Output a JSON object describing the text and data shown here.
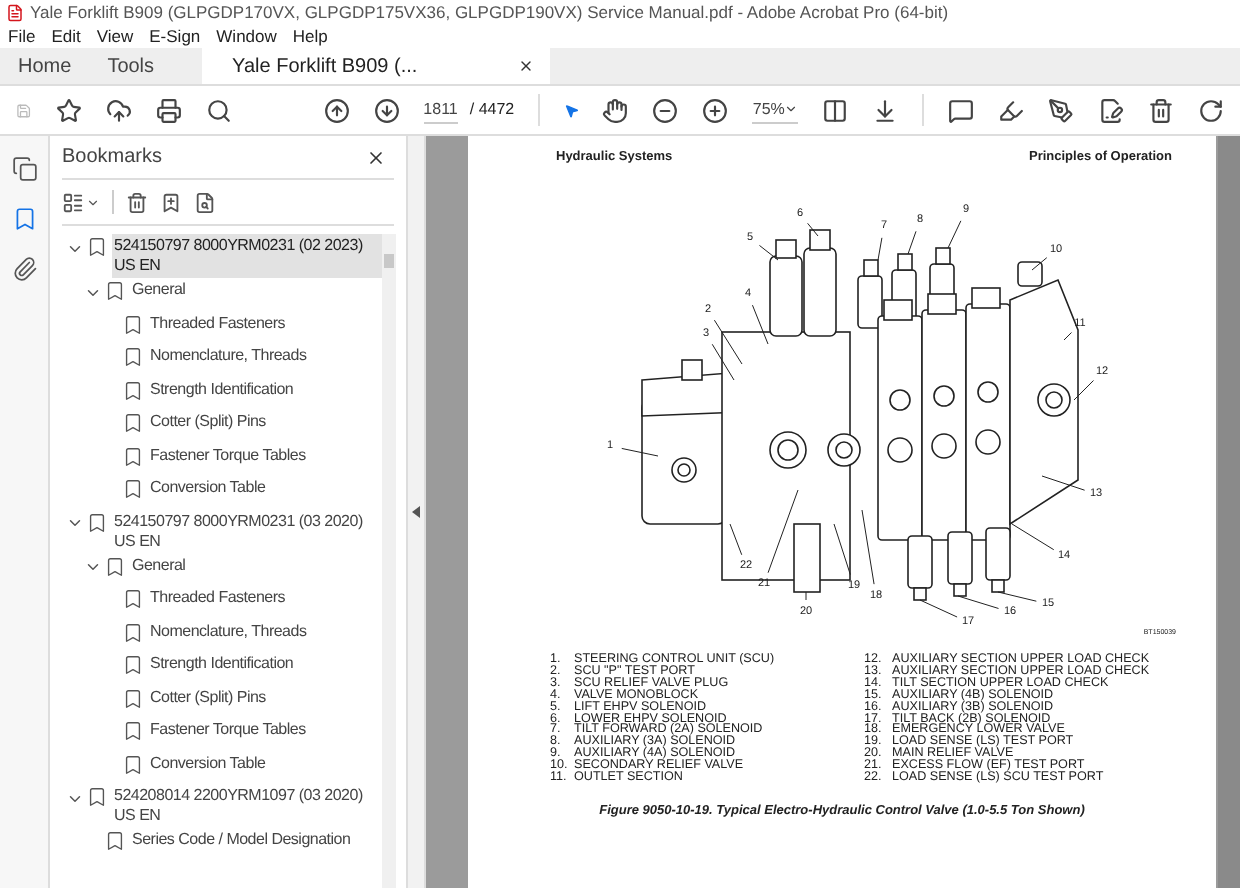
{
  "window": {
    "title": "Yale Forklift B909 (GLPGDP170VX, GLPGDP175VX36, GLPGDP190VX) Service Manual.pdf - Adobe Acrobat Pro (64-bit)"
  },
  "menu": [
    "File",
    "Edit",
    "View",
    "E-Sign",
    "Window",
    "Help"
  ],
  "tabs": [
    {
      "label": "Home",
      "selected": false,
      "kind": "nav"
    },
    {
      "label": "Tools",
      "selected": false,
      "kind": "nav"
    },
    {
      "label": "Yale Forklift B909 (...",
      "selected": true,
      "kind": "document"
    }
  ],
  "toolbar": {
    "page": "1811",
    "page_count": "/ 4472",
    "zoom": "75%"
  },
  "side_rail": [
    {
      "kind": "pages",
      "selected": false
    },
    {
      "kind": "bookmarks",
      "selected": true
    },
    {
      "kind": "attachments",
      "selected": false
    }
  ],
  "bookmarks": {
    "title": "Bookmarks",
    "items": [
      {
        "label": "524150797 8000YRM0231 (02 2023) US EN",
        "selected": true,
        "expanded": true,
        "children": [
          {
            "label": "General",
            "selected": false,
            "expanded": true,
            "children": [
              {
                "label": "Threaded Fasteners",
                "selected": false
              },
              {
                "label": "Nomenclature, Threads",
                "selected": false
              },
              {
                "label": "Strength Identification",
                "selected": false
              },
              {
                "label": "Cotter (Split) Pins",
                "selected": false
              },
              {
                "label": "Fastener Torque Tables",
                "selected": false
              },
              {
                "label": "Conversion Table",
                "selected": false
              }
            ]
          }
        ]
      },
      {
        "label": "524150797 8000YRM0231 (03 2020) US EN",
        "selected": false,
        "expanded": true,
        "children": [
          {
            "label": "General",
            "selected": false,
            "expanded": true,
            "children": [
              {
                "label": "Threaded Fasteners",
                "selected": false
              },
              {
                "label": "Nomenclature, Threads",
                "selected": false
              },
              {
                "label": "Strength Identification",
                "selected": false
              },
              {
                "label": "Cotter (Split) Pins",
                "selected": false
              },
              {
                "label": "Fastener Torque Tables",
                "selected": false
              },
              {
                "label": "Conversion Table",
                "selected": false
              }
            ]
          }
        ]
      },
      {
        "label": "524208014 2200YRM1097 (03 2020) US EN",
        "selected": false,
        "expanded": true,
        "children": [
          {
            "label": "Series Code / Model Designation",
            "selected": false
          }
        ]
      }
    ]
  },
  "document": {
    "header_left": "Hydraulic Systems",
    "header_right": "Principles of Operation",
    "callouts": [
      "9",
      "6",
      "8",
      "7",
      "5",
      "10",
      "4",
      "2",
      "11",
      "3",
      "12",
      "1",
      "13",
      "14",
      "22",
      "21",
      "19",
      "18",
      "15",
      "20",
      "16",
      "17"
    ],
    "figure_id": "BT150039",
    "legend": [
      {
        "num": "1.",
        "text": "STEERING CONTROL UNIT (SCU)"
      },
      {
        "num": "2.",
        "text": "SCU \"P\" TEST PORT"
      },
      {
        "num": "3.",
        "text": "SCU RELIEF VALVE PLUG"
      },
      {
        "num": "4.",
        "text": "VALVE MONOBLOCK"
      },
      {
        "num": "5.",
        "text": "LIFT EHPV SOLENOID"
      },
      {
        "num": "6.",
        "text": "LOWER EHPV SOLENOID"
      },
      {
        "num": "7.",
        "text": "TILT FORWARD (2A) SOLENOID"
      },
      {
        "num": "8.",
        "text": "AUXILIARY (3A) SOLENOID"
      },
      {
        "num": "9.",
        "text": "AUXILIARY (4A) SOLENOID"
      },
      {
        "num": "10.",
        "text": "SECONDARY RELIEF VALVE"
      },
      {
        "num": "11.",
        "text": "OUTLET SECTION"
      },
      {
        "num": "12.",
        "text": "AUXILIARY SECTION UPPER LOAD CHECK"
      },
      {
        "num": "13.",
        "text": "AUXILIARY SECTION UPPER LOAD CHECK"
      },
      {
        "num": "14.",
        "text": "TILT SECTION UPPER LOAD CHECK"
      },
      {
        "num": "15.",
        "text": "AUXILIARY (4B) SOLENOID"
      },
      {
        "num": "16.",
        "text": "AUXILIARY (3B) SOLENOID"
      },
      {
        "num": "17.",
        "text": "TILT BACK (2B) SOLENOID"
      },
      {
        "num": "18.",
        "text": "EMERGENCY LOWER VALVE"
      },
      {
        "num": "19.",
        "text": "LOAD SENSE (LS) TEST PORT"
      },
      {
        "num": "20.",
        "text": "MAIN RELIEF VALVE"
      },
      {
        "num": "21.",
        "text": "EXCESS FLOW (EF) TEST PORT"
      },
      {
        "num": "22.",
        "text": "LOAD SENSE (LS) SCU TEST PORT"
      }
    ],
    "caption": "Figure 9050-10-19. Typical Electro-Hydraulic Control Valve (1.0-5.5 Ton Shown)"
  }
}
